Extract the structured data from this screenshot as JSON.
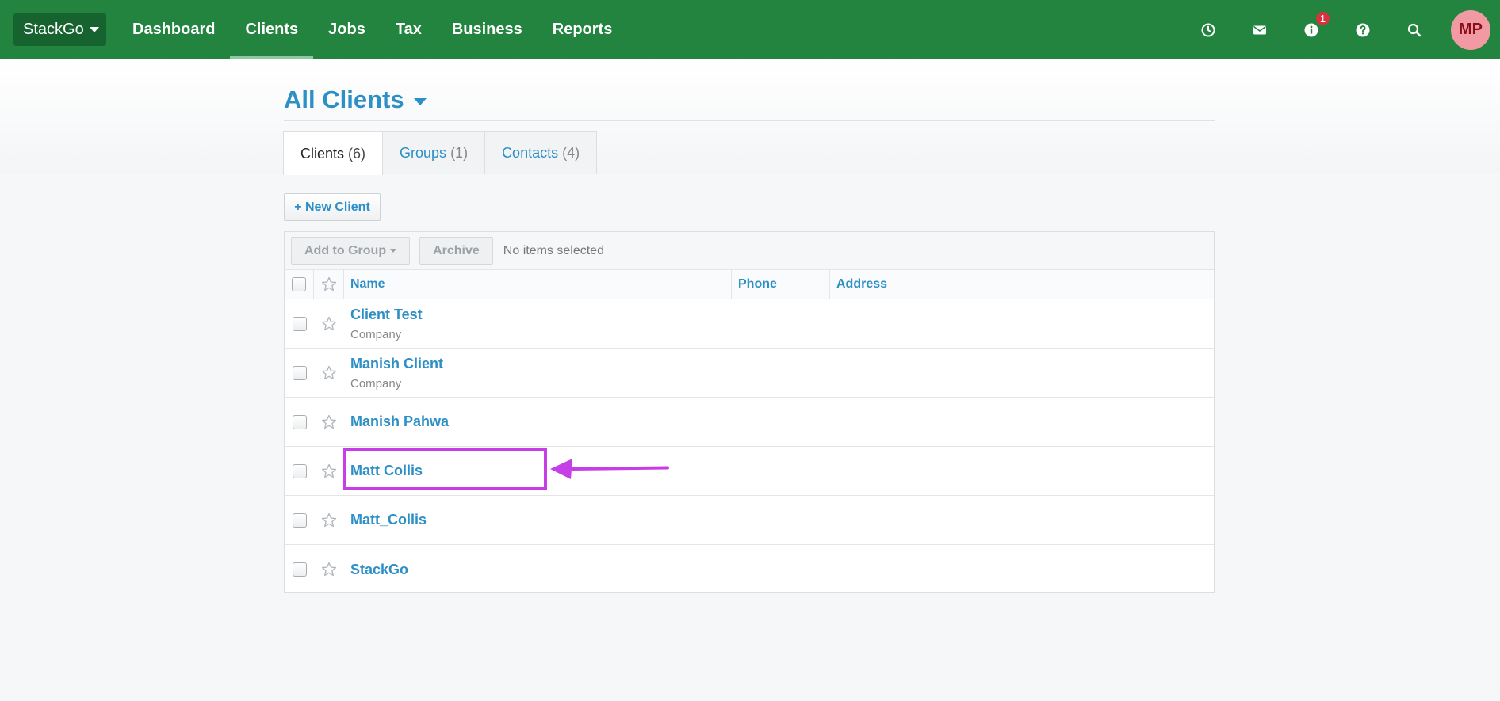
{
  "nav": {
    "org_label": "StackGo",
    "links": [
      {
        "label": "Dashboard",
        "active": false
      },
      {
        "label": "Clients",
        "active": true
      },
      {
        "label": "Jobs",
        "active": false
      },
      {
        "label": "Tax",
        "active": false
      },
      {
        "label": "Business",
        "active": false
      },
      {
        "label": "Reports",
        "active": false
      }
    ],
    "notification_count": "1",
    "avatar_initials": "MP"
  },
  "page": {
    "title": "All Clients",
    "tabs": [
      {
        "label": "Clients",
        "count": "(6)",
        "active": true
      },
      {
        "label": "Groups",
        "count": "(1)",
        "active": false
      },
      {
        "label": "Contacts",
        "count": "(4)",
        "active": false
      }
    ]
  },
  "actions": {
    "new_client_label": "+ New Client"
  },
  "toolbar": {
    "add_to_group_label": "Add to Group",
    "archive_label": "Archive",
    "status_text": "No items selected"
  },
  "table": {
    "columns": {
      "name": "Name",
      "phone": "Phone",
      "address": "Address"
    },
    "rows": [
      {
        "name": "Client Test",
        "sub": "Company"
      },
      {
        "name": "Manish Client",
        "sub": "Company"
      },
      {
        "name": "Manish Pahwa",
        "sub": ""
      },
      {
        "name": "Matt Collis",
        "sub": ""
      },
      {
        "name": "Matt_Collis",
        "sub": ""
      },
      {
        "name": "StackGo",
        "sub": ""
      }
    ]
  },
  "colors": {
    "nav_green": "#22843f",
    "link_blue": "#2c8fc6",
    "annotation_magenta": "#c63fe6",
    "badge_red": "#d6333e"
  }
}
